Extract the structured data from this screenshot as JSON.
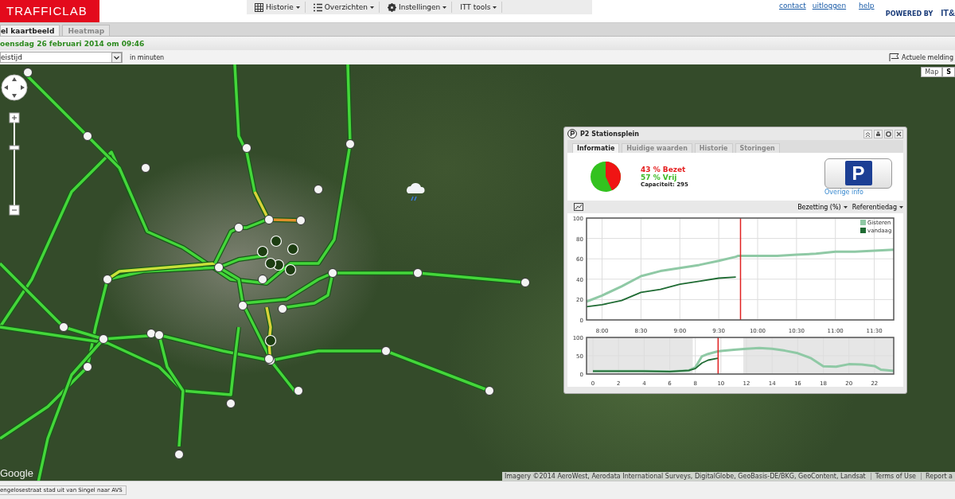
{
  "header": {
    "logo": "TRAFFICLAB",
    "menu": [
      {
        "label": "Historie",
        "kind": "grid"
      },
      {
        "label": "Overzichten",
        "kind": "list"
      },
      {
        "label": "Instellingen",
        "kind": "gear"
      },
      {
        "label": "ITT tools",
        "kind": "plain"
      }
    ],
    "links": [
      "contact",
      "uitloggen",
      "help"
    ],
    "powered_by": "POWERED BY",
    "partner_logo": "IT&"
  },
  "tabs": [
    {
      "label": "el kaartbeeld",
      "selected": true
    },
    {
      "label": "Heatmap",
      "selected": false
    }
  ],
  "date_line": "oensdag 26 februari 2014 om 09:46",
  "filter": {
    "select_value": "eistijd",
    "unit": "in minuten",
    "notifications": "Actuele melding"
  },
  "map": {
    "type_buttons": [
      {
        "label": "Map",
        "selected": false
      },
      {
        "label": "S",
        "selected": true
      }
    ],
    "google": "Google",
    "attribution": "Imagery ©2014 AeroWest, Aerodata International Surveys, DigitalGlobe, GeoBasis-DE/BKG, GeoContent, Landsat",
    "terms": "Terms of Use",
    "report": "Report a"
  },
  "popup": {
    "title": "P2 Stationsplein",
    "tabs": [
      {
        "label": "Informatie",
        "selected": true
      },
      {
        "label": "Huidige waarden",
        "selected": false
      },
      {
        "label": "Historie",
        "selected": false
      },
      {
        "label": "Storingen",
        "selected": false
      }
    ],
    "occupancy": {
      "level": 0.43
    },
    "occupied": "43 % Bezet",
    "free": "57 % Vrij",
    "capacity": "Capaciteit: 295",
    "p_sign": "P",
    "more_info": "Overige info",
    "dropdowns": [
      "Bezetting (%)",
      "Referentiedag"
    ],
    "main_chart": {
      "chart_data": {
        "type": "line",
        "x": [
          7.8,
          8,
          8.25,
          8.5,
          8.75,
          9,
          9.25,
          9.5,
          9.72,
          9.75,
          10,
          10.25,
          10.5,
          10.75,
          11,
          11.25,
          11.5,
          11.75
        ],
        "xlim": [
          7.8,
          11.75
        ],
        "ylim": [
          0,
          100
        ],
        "xticks": [
          {
            "value": 8,
            "label": "8:00"
          },
          {
            "value": 8.5,
            "label": "8:30"
          },
          {
            "value": 9,
            "label": "9:00"
          },
          {
            "value": 9.5,
            "label": "9:30"
          },
          {
            "value": 10,
            "label": "10:00"
          },
          {
            "value": 10.5,
            "label": "10:30"
          },
          {
            "value": 11,
            "label": "11:00"
          },
          {
            "value": 11.5,
            "label": "11:30"
          }
        ],
        "yticks": [
          0,
          20,
          40,
          60,
          80,
          100
        ],
        "series": [
          {
            "name": "Gisteren",
            "color": "#8fc9a5",
            "values": [
              18,
              24,
              33,
              43,
              48,
              51,
              54,
              58,
              62,
              63,
              63,
              63,
              64,
              65,
              67,
              67,
              68,
              69
            ]
          },
          {
            "name": "vandaag",
            "color": "#1f6b33",
            "values": [
              13,
              15,
              19,
              27,
              30,
              35,
              38,
              41,
              42,
              null,
              null,
              null,
              null,
              null,
              null,
              null,
              null,
              null
            ]
          }
        ],
        "grid": true,
        "legend": "upper right",
        "ref_lines": [
          {
            "axis": "x",
            "value": 9.78
          }
        ]
      }
    },
    "overview_chart": {
      "chart_data": {
        "type": "line",
        "x": [
          0,
          2,
          4,
          6,
          7,
          7.5,
          8,
          8.5,
          9,
          9.75,
          10,
          11,
          12,
          13,
          14,
          15,
          16,
          17,
          18,
          19,
          20,
          21,
          22,
          22.5,
          23.5
        ],
        "xlim": [
          -0.5,
          23.5
        ],
        "ylim": [
          0,
          100
        ],
        "xticks": [
          0,
          2,
          4,
          6,
          8,
          10,
          12,
          14,
          16,
          18,
          20,
          22
        ],
        "yticks": [
          0,
          50,
          100
        ],
        "series": [
          {
            "color": "#8fc9a5",
            "values": [
              8,
              8,
              8,
              7,
              9,
              10,
              18,
              48,
              55,
              62,
              63,
              66,
              69,
              71,
              69,
              64,
              57,
              44,
              21,
              20,
              27,
              26,
              22,
              12,
              9
            ]
          },
          {
            "color": "#1f6b33",
            "values": [
              8,
              8,
              8,
              7,
              9,
              10,
              15,
              30,
              38,
              43,
              null,
              null,
              null,
              null,
              null,
              null,
              null,
              null,
              null,
              null,
              null,
              null,
              null,
              null,
              null
            ]
          }
        ],
        "grid": true,
        "bands": [
          {
            "axis": "x",
            "from": -0.5,
            "to": 7.8
          },
          {
            "axis": "x",
            "from": 11.75,
            "to": 23.5
          }
        ],
        "ref_lines": [
          {
            "axis": "x",
            "value": 9.78
          }
        ]
      }
    }
  },
  "status_bar": "engelosestraat stad uit van Singel naar AVS"
}
